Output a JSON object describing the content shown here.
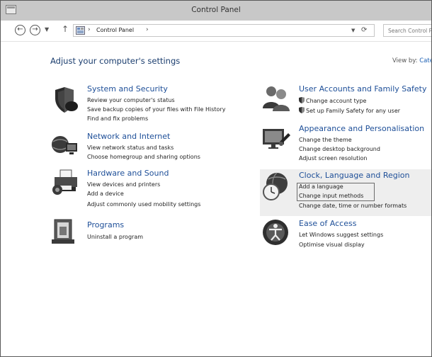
{
  "window": {
    "title": "Control Panel"
  },
  "address": {
    "back_icon": "back-arrow-icon",
    "forward_icon": "forward-arrow-icon",
    "recent_icon": "chevron-down-icon",
    "up_icon": "up-arrow-icon",
    "breadcrumb": "Control Panel",
    "separator": "›",
    "dropdown_icon": "chevron-down-icon",
    "refresh_icon": "refresh-icon",
    "search_placeholder": "Search Control Panel"
  },
  "main": {
    "heading": "Adjust your computer's settings",
    "view_by_label": "View by:",
    "view_by_value": "Category"
  },
  "categories": [
    {
      "title": "System and Security",
      "icon": "shield-icon",
      "links": [
        "Review your computer's status",
        "Save backup copies of your files with File History",
        "Find and fix problems"
      ]
    },
    {
      "title": "Network and Internet",
      "icon": "network-icon",
      "links": [
        "View network status and tasks",
        "Choose homegroup and sharing options"
      ]
    },
    {
      "title": "Hardware and Sound",
      "icon": "printer-icon",
      "links": [
        "View devices and printers",
        "Add a device",
        "Adjust commonly used mobility settings"
      ]
    },
    {
      "title": "Programs",
      "icon": "programs-icon",
      "links": [
        "Uninstall a program"
      ]
    },
    {
      "title": "User Accounts and Family Safety",
      "icon": "users-icon",
      "links": [
        "Change account type",
        "Set up Family Safety for any user"
      ]
    },
    {
      "title": "Appearance and Personalisation",
      "icon": "appearance-icon",
      "links": [
        "Change the theme",
        "Change desktop background",
        "Adjust screen resolution"
      ]
    },
    {
      "title": "Clock, Language and Region",
      "icon": "clock-globe-icon",
      "links": [
        "Add a language",
        "Change input methods",
        "Change date, time or number formats"
      ]
    },
    {
      "title": "Ease of Access",
      "icon": "ease-of-access-icon",
      "links": [
        "Let Windows suggest settings",
        "Optimise visual display"
      ]
    }
  ]
}
